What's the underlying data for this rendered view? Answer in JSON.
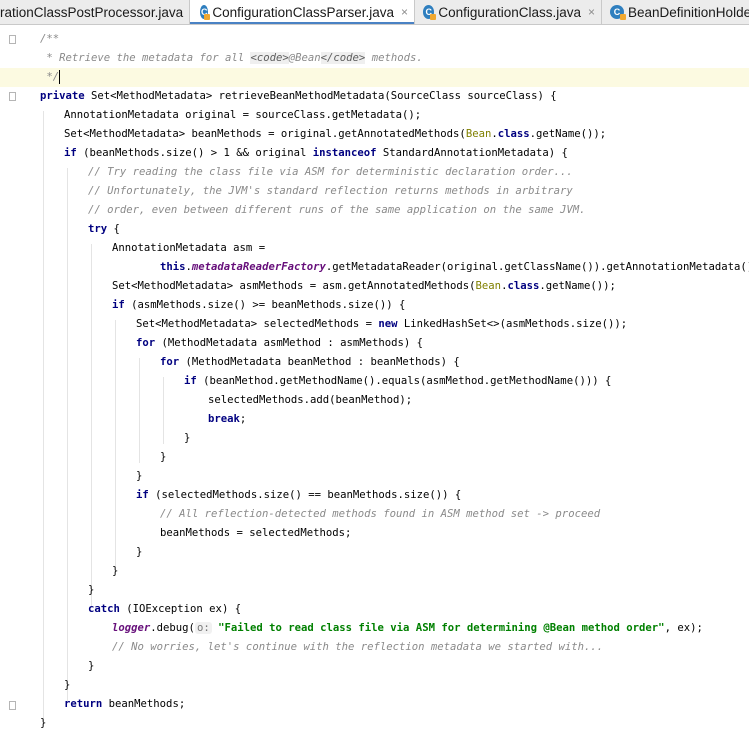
{
  "tabs": [
    {
      "label": "rationClassPostProcessor.java",
      "active": false,
      "icon": "class-icon"
    },
    {
      "label": "ConfigurationClassParser.java",
      "active": true,
      "icon": "class-icon"
    },
    {
      "label": "ConfigurationClass.java",
      "active": false,
      "icon": "class-icon"
    },
    {
      "label": "BeanDefinitionHolder",
      "active": false,
      "icon": "class-icon"
    }
  ],
  "tab_close_glyph": "×",
  "code": {
    "l1": "/**",
    "l2_a": " * Retrieve the metadata for all ",
    "l2_tag_open": "<code>",
    "l2_b": "@Bean",
    "l2_tag_close": "</code>",
    "l2_c": " methods.",
    "l3": " */",
    "l4_kw": "private",
    "l4_rest": " Set<MethodMetadata> retrieveBeanMethodMetadata(SourceClass sourceClass) {",
    "l5": "AnnotationMetadata original = sourceClass.getMetadata();",
    "l6_a": "Set<MethodMetadata> beanMethods = original.getAnnotatedMethods(",
    "l6_ann": "Bean",
    "l6_dot": ".",
    "l6_kw": "class",
    "l6_b": ".getName());",
    "l7_kw": "if",
    "l7_a": " (beanMethods.size() > 1 && original ",
    "l7_kw2": "instanceof",
    "l7_b": " StandardAnnotationMetadata) {",
    "l8": "// Try reading the class file via ASM for deterministic declaration order...",
    "l9": "// Unfortunately, the JVM's standard reflection returns methods in arbitrary",
    "l10": "// order, even between different runs of the same application on the same JVM.",
    "l11_kw": "try",
    "l11_b": " {",
    "l12": "AnnotationMetadata asm =",
    "l13_kw": "this",
    "l13_dot": ".",
    "l13_fd": "metadataReaderFactory",
    "l13_b": ".getMetadataReader(original.getClassName()).getAnnotationMetadata();",
    "l14_a": "Set<MethodMetadata> asmMethods = asm.getAnnotatedMethods(",
    "l14_ann": "Bean",
    "l14_dot": ".",
    "l14_kw": "class",
    "l14_b": ".getName());",
    "l15_kw": "if",
    "l15_b": " (asmMethods.size() >= beanMethods.size()) {",
    "l16_a": "Set<MethodMetadata> selectedMethods = ",
    "l16_kw": "new",
    "l16_b": " LinkedHashSet<>(asmMethods.size());",
    "l17_kw": "for",
    "l17_b": " (MethodMetadata asmMethod : asmMethods) {",
    "l18_kw": "for",
    "l18_b": " (MethodMetadata beanMethod : beanMethods) {",
    "l19_kw": "if",
    "l19_b": " (beanMethod.getMethodName().equals(asmMethod.getMethodName())) {",
    "l20": "selectedMethods.add(beanMethod);",
    "l21_kw": "break",
    "l21_b": ";",
    "l22": "}",
    "l23": "}",
    "l24": "}",
    "l25_kw": "if",
    "l25_b": " (selectedMethods.size() == beanMethods.size()) {",
    "l26": "// All reflection-detected methods found in ASM method set -> proceed",
    "l27": "beanMethods = selectedMethods;",
    "l28": "}",
    "l29": "}",
    "l30": "}",
    "l31_kw": "catch",
    "l31_b": " (IOException ex) {",
    "l32_fd": "logger",
    "l32_a": ".debug(",
    "l32_hint": "o:",
    "l32_str": "\"Failed to read class file via ASM for determining @Bean method order\"",
    "l32_b": ", ex);",
    "l33": "// No worries, let's continue with the reflection metadata we started with...",
    "l34": "}",
    "l35": "}",
    "l36_kw": "return",
    "l36_b": " beanMethods;",
    "l37": "}"
  }
}
